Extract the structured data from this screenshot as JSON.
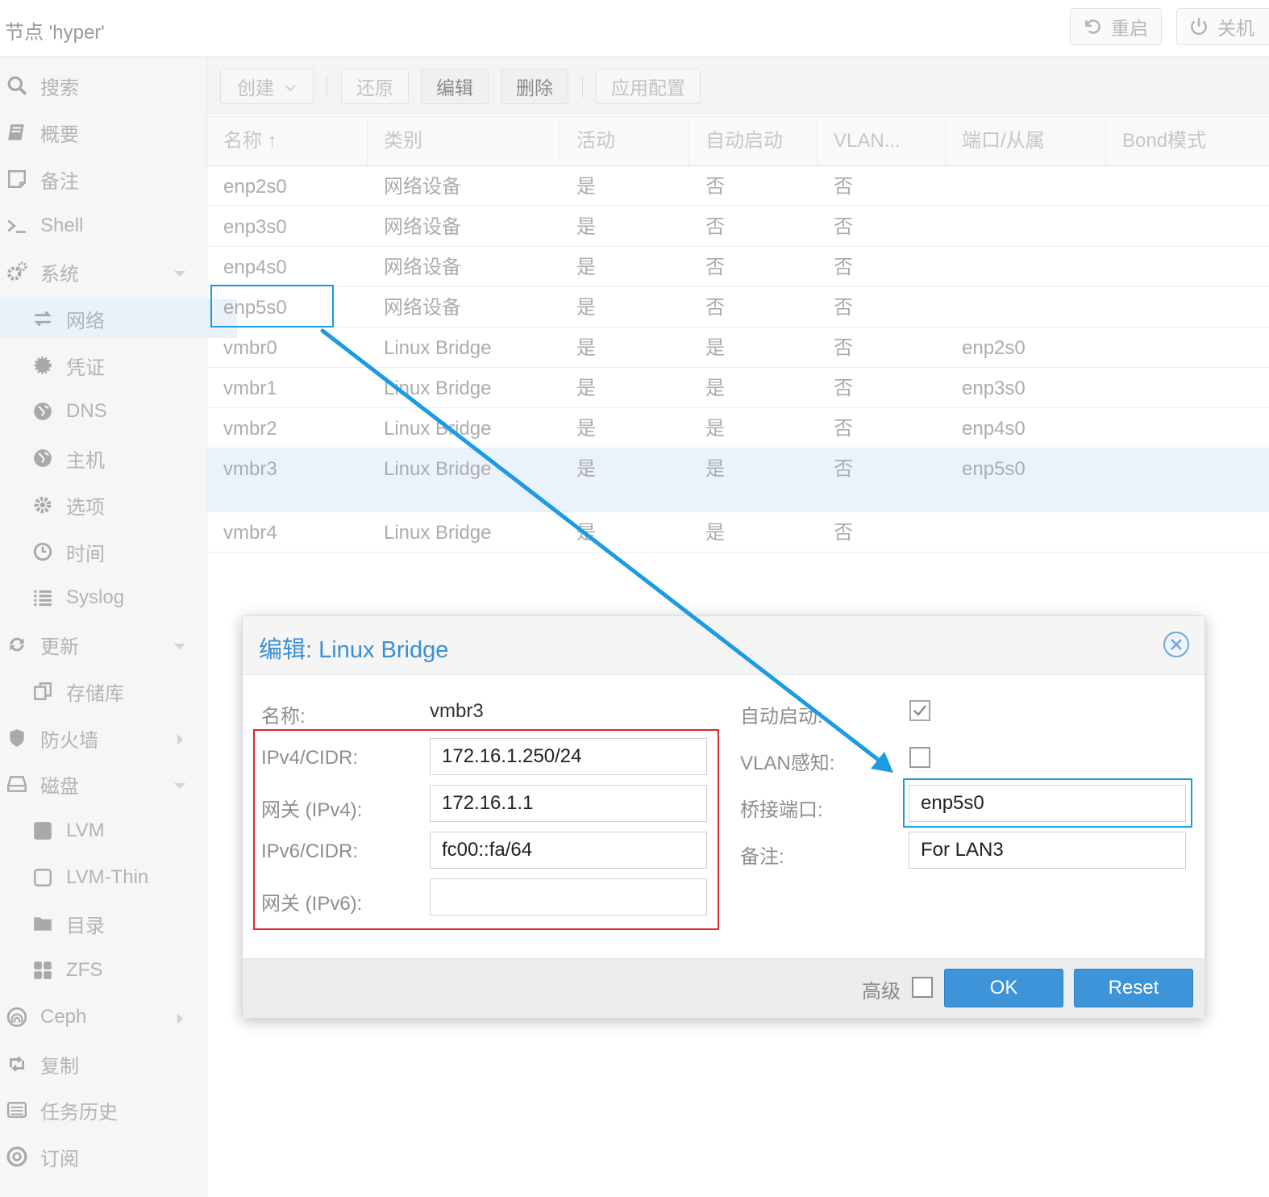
{
  "header": {
    "node_title": "节点 'hyper'",
    "restart_label": "重启",
    "shutdown_label": "关机"
  },
  "sidebar": {
    "items": [
      {
        "label": "搜索",
        "icon": "search-icon"
      },
      {
        "label": "概要",
        "icon": "book-icon"
      },
      {
        "label": "备注",
        "icon": "note-icon"
      },
      {
        "label": "Shell",
        "icon": "terminal-icon"
      },
      {
        "label": "系统",
        "icon": "gears-icon"
      },
      {
        "label": "网络",
        "icon": "exchange-icon"
      },
      {
        "label": "凭证",
        "icon": "certificate-icon"
      },
      {
        "label": "DNS",
        "icon": "globe-icon"
      },
      {
        "label": "主机",
        "icon": "globe-icon"
      },
      {
        "label": "选项",
        "icon": "gear-icon"
      },
      {
        "label": "时间",
        "icon": "clock-icon"
      },
      {
        "label": "Syslog",
        "icon": "list-icon"
      },
      {
        "label": "更新",
        "icon": "refresh-icon"
      },
      {
        "label": "存储库",
        "icon": "copy-icon"
      },
      {
        "label": "防火墙",
        "icon": "shield-icon"
      },
      {
        "label": "磁盘",
        "icon": "hdd-icon"
      },
      {
        "label": "LVM",
        "icon": "square-icon"
      },
      {
        "label": "LVM-Thin",
        "icon": "square-outline-icon"
      },
      {
        "label": "目录",
        "icon": "folder-icon"
      },
      {
        "label": "ZFS",
        "icon": "th-large-icon"
      },
      {
        "label": "Ceph",
        "icon": "ceph-icon"
      },
      {
        "label": "复制",
        "icon": "retweet-icon"
      },
      {
        "label": "任务历史",
        "icon": "list-alt-icon"
      },
      {
        "label": "订阅",
        "icon": "support-icon"
      }
    ]
  },
  "toolbar": {
    "create_label": "创建",
    "revert_label": "还原",
    "edit_label": "编辑",
    "delete_label": "删除",
    "apply_label": "应用配置"
  },
  "grid": {
    "columns": [
      "名称 ↑",
      "类别",
      "活动",
      "自动启动",
      "VLAN...",
      "端口/从属",
      "Bond模式"
    ],
    "rows": [
      [
        "enp2s0",
        "网络设备",
        "是",
        "否",
        "否",
        ""
      ],
      [
        "enp3s0",
        "网络设备",
        "是",
        "否",
        "否",
        ""
      ],
      [
        "enp4s0",
        "网络设备",
        "是",
        "否",
        "否",
        ""
      ],
      [
        "enp5s0",
        "网络设备",
        "是",
        "否",
        "否",
        ""
      ],
      [
        "vmbr0",
        "Linux Bridge",
        "是",
        "是",
        "否",
        "enp2s0"
      ],
      [
        "vmbr1",
        "Linux Bridge",
        "是",
        "是",
        "否",
        "enp3s0"
      ],
      [
        "vmbr2",
        "Linux Bridge",
        "是",
        "是",
        "否",
        "enp4s0"
      ],
      [
        "vmbr3",
        "Linux Bridge",
        "是",
        "是",
        "否",
        "enp5s0"
      ],
      [
        "vmbr4",
        "Linux Bridge",
        "是",
        "是",
        "否",
        ""
      ]
    ]
  },
  "dialog": {
    "title": "编辑: Linux Bridge",
    "name_label": "名称:",
    "name_value": "vmbr3",
    "ipv4_label": "IPv4/CIDR:",
    "ipv4_value": "172.16.1.250/24",
    "gw4_label": "网关 (IPv4):",
    "gw4_value": "172.16.1.1",
    "ipv6_label": "IPv6/CIDR:",
    "ipv6_value": "fc00::fa/64",
    "gw6_label": "网关 (IPv6):",
    "gw6_value": "",
    "autostart_label": "自动启动:",
    "autostart_checked": true,
    "vlan_label": "VLAN感知:",
    "vlan_checked": false,
    "bridge_ports_label": "桥接端口:",
    "bridge_ports_value": "enp5s0",
    "comment_label": "备注:",
    "comment_value": "For LAN3",
    "advanced_label": "高级",
    "ok_label": "OK",
    "reset_label": "Reset"
  },
  "colors": {
    "accent": "#3d94d9",
    "annotation_red": "#e0242c",
    "annotation_blue": "#1a9be3"
  }
}
